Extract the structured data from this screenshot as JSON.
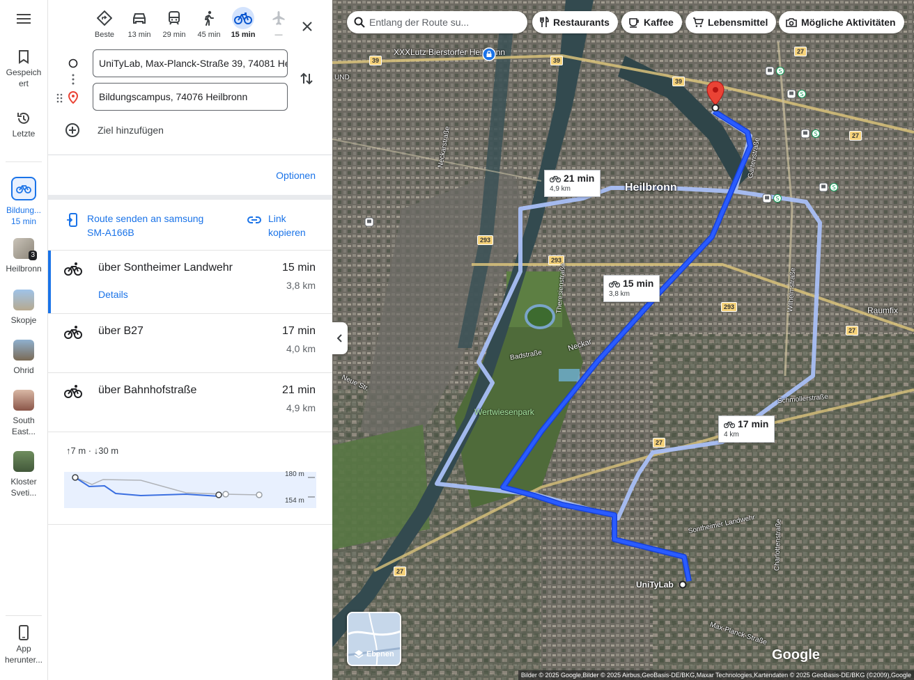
{
  "rail": {
    "menu_icon": "menu-icon",
    "saved_label": "Gespeich ert",
    "recent_label": "Letzte",
    "active_route": {
      "label": "Bildung...",
      "time": "15 min",
      "icon": "bicycle-icon"
    },
    "recent_places": [
      {
        "label": "Heilbronn",
        "badge": "3"
      },
      {
        "label": "Skopje"
      },
      {
        "label": "Ohrid"
      },
      {
        "label": "South East..."
      },
      {
        "label": "Kloster Sveti..."
      }
    ],
    "app_label": "App herunter..."
  },
  "modes": [
    {
      "label": "Beste",
      "icon": "diamond-route-icon",
      "active": false
    },
    {
      "label": "13 min",
      "icon": "car-icon",
      "active": false
    },
    {
      "label": "29 min",
      "icon": "transit-icon",
      "active": false
    },
    {
      "label": "45 min",
      "icon": "walk-icon",
      "active": false
    },
    {
      "label": "15 min",
      "icon": "bicycle-icon",
      "active": true
    },
    {
      "label": "—",
      "icon": "flight-icon",
      "active": false
    }
  ],
  "waypoints": {
    "origin": "UniTyLab, Max-Planck-Straße 39, 74081 Heilbronn",
    "destination": "Bildungscampus, 74076 Heilbronn",
    "add_label": "Ziel hinzufügen"
  },
  "options_label": "Optionen",
  "share": {
    "send_label_line1": "Route senden an samsung",
    "send_label_line2": "SM-A166B",
    "copy_label_line1": "Link",
    "copy_label_line2": "kopieren"
  },
  "routes": [
    {
      "name": "über Sontheimer Landwehr",
      "time": "15 min",
      "distance": "3,8 km",
      "details": "Details",
      "selected": true
    },
    {
      "name": "über B27",
      "time": "17 min",
      "distance": "4,0 km"
    },
    {
      "name": "über Bahnhofstraße",
      "time": "21 min",
      "distance": "4,9 km"
    }
  ],
  "elevation": {
    "summary": "↑7 m · ↓30 m",
    "max_label": "180 m",
    "min_label": "154 m"
  },
  "map": {
    "search_placeholder": "Entlang der Route su...",
    "chips": [
      {
        "label": "Restaurants",
        "icon": "fork-knife-icon"
      },
      {
        "label": "Kaffee",
        "icon": "coffee-icon"
      },
      {
        "label": "Lebensmittel",
        "icon": "cart-icon"
      },
      {
        "label": "Mögliche Aktivitäten",
        "icon": "camera-icon"
      }
    ],
    "route_labels": [
      {
        "time": "21 min",
        "distance": "4,9 km"
      },
      {
        "time": "15 min",
        "distance": "3,8 km"
      },
      {
        "time": "17 min",
        "distance": "4 km"
      }
    ],
    "city": "Heilbronn",
    "poi": [
      "XXXLutz Bierstorfer Heilbronn",
      "UniTyLab",
      "Raumfix"
    ],
    "park": "Wertwiesenpark",
    "streets": [
      "Neckarstraße",
      "Badstraße",
      "Neckar",
      "Schmollerstraße",
      "Sontheimer Landwehr",
      "Max-Planck-Straße",
      "Charlottenstraße",
      "Wilhelmstraße",
      "Neue Str.",
      "Theresienstraße",
      "Gartenstraße",
      "UND"
    ],
    "road_numbers": [
      "39",
      "39",
      "39",
      "27",
      "27",
      "27",
      "27",
      "27",
      "293",
      "293",
      "293"
    ],
    "layers_label": "Ebenen",
    "google_logo": "Google",
    "attribution": "Bilder © 2025 Google,Bilder © 2025 Airbus,GeoBasis-DE/BKG,Maxar Technologies,Kartendaten © 2025 GeoBasis-DE/BKG (©2009),Google",
    "colors": {
      "selected_route": "#1a3cf0",
      "alt_route": "#a9bff5",
      "pin": "#ea4335",
      "accent": "#1a73e8"
    }
  }
}
